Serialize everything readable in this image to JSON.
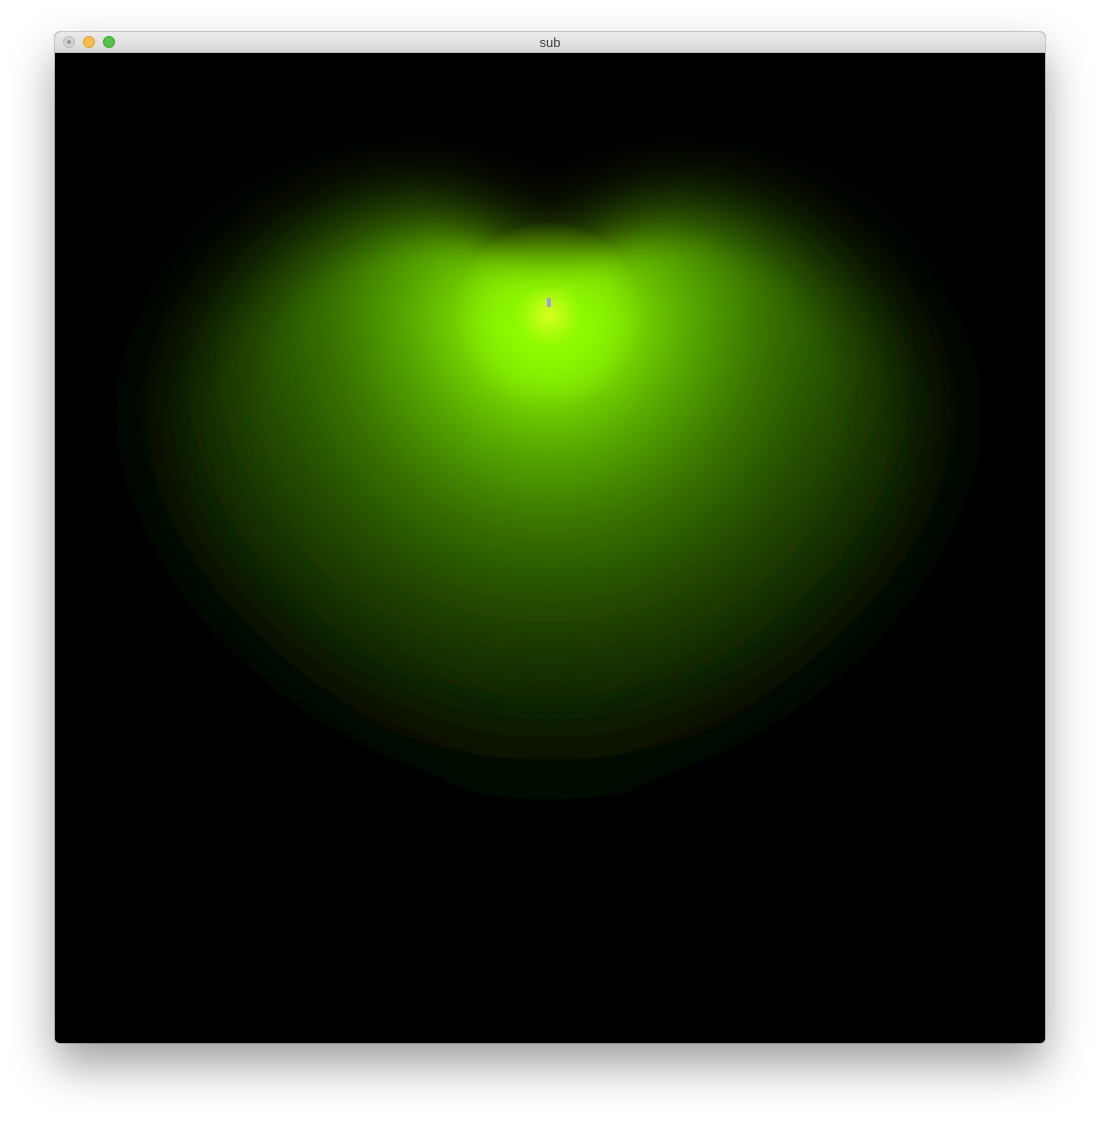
{
  "window": {
    "title": "sub",
    "controls": {
      "close": "close-icon",
      "minimize": "minimize-icon",
      "maximize": "maximize-icon"
    }
  },
  "canvas": {
    "background_color": "#000000",
    "shape": "heart",
    "glow_color": "#8cff00",
    "highlight_color": "#ffff40",
    "cursor_color": "#a99ad8"
  }
}
